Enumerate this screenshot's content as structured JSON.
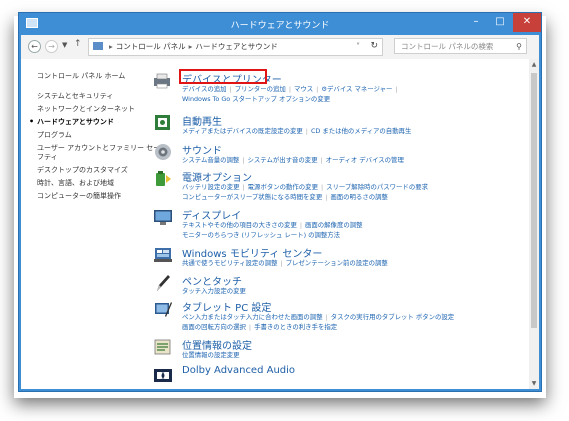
{
  "window": {
    "title": "ハードウェアとサウンド"
  },
  "address": {
    "path": [
      "コントロール パネル",
      "ハードウェアとサウンド"
    ],
    "search_placeholder": "コントロール パネルの検索"
  },
  "sidebar": {
    "items": [
      {
        "label": "コントロール パネル ホーム"
      },
      {
        "label": "システムとセキュリティ"
      },
      {
        "label": "ネットワークとインターネット"
      },
      {
        "label": "ハードウェアとサウンド"
      },
      {
        "label": "プログラム"
      },
      {
        "label": "ユーザー アカウントとファミリー セー"
      },
      {
        "label": "フティ"
      },
      {
        "label": "デスクトップのカスタマイズ"
      },
      {
        "label": "時計、言語、および地域"
      },
      {
        "label": "コンピューターの簡単操作"
      }
    ]
  },
  "sections": [
    {
      "title": "デバイスとプリンター",
      "icon": "printer-icon",
      "links": [
        [
          "デバイスの追加",
          "プリンターの追加",
          "マウス",
          "デバイス マネージャー"
        ],
        [
          "Windows To Go スタートアップ オプションの変更"
        ]
      ]
    },
    {
      "title": "自動再生",
      "icon": "autoplay-icon",
      "links": [
        [
          "メディアまたはデバイスの既定設定の変更",
          "CD または他のメディアの自動再生"
        ]
      ]
    },
    {
      "title": "サウンド",
      "icon": "speaker-icon",
      "links": [
        [
          "システム音量の調整",
          "システムが出す音の変更",
          "オーディオ デバイスの管理"
        ]
      ]
    },
    {
      "title": "電源オプション",
      "icon": "power-icon",
      "links": [
        [
          "バッテリ設定の変更",
          "電源ボタンの動作の変更",
          "スリープ解除時のパスワードの要求"
        ],
        [
          "コンピューターがスリープ状態になる時間を変更",
          "画面の明るさの調整"
        ]
      ]
    },
    {
      "title": "ディスプレイ",
      "icon": "display-icon",
      "links": [
        [
          "テキストやその他の項目の大きさの変更",
          "画面の解像度の調整"
        ],
        [
          "モニターのちらつき (リフレッシュ レート) の調整方法"
        ]
      ]
    },
    {
      "title": "Windows モビリティ センター",
      "icon": "mobility-icon",
      "links": [
        [
          "共通で使うモビリティ設定の調整",
          "プレゼンテーション前の設定の調整"
        ]
      ]
    },
    {
      "title": "ペンとタッチ",
      "icon": "pen-icon",
      "links": [
        [
          "タッチ入力設定の変更"
        ]
      ]
    },
    {
      "title": "タブレット PC 設定",
      "icon": "tablet-icon",
      "links": [
        [
          "ペン入力またはタッチ入力に合わせた画面の調整",
          "タスクの実行用のタブレット ボタンの設定"
        ],
        [
          "画面の回転方向の選択",
          "手書きのときの利き手を指定"
        ]
      ]
    },
    {
      "title": "位置情報の設定",
      "icon": "location-icon",
      "links": [
        [
          "位置情報の設定変更"
        ]
      ]
    },
    {
      "title": "Dolby Advanced Audio",
      "icon": "dolby-icon",
      "links": []
    }
  ],
  "colors": {
    "titlebar": "#3e8ed6",
    "close": "#c7403a",
    "highlight": "#e01414",
    "link": "#1c63b0"
  }
}
